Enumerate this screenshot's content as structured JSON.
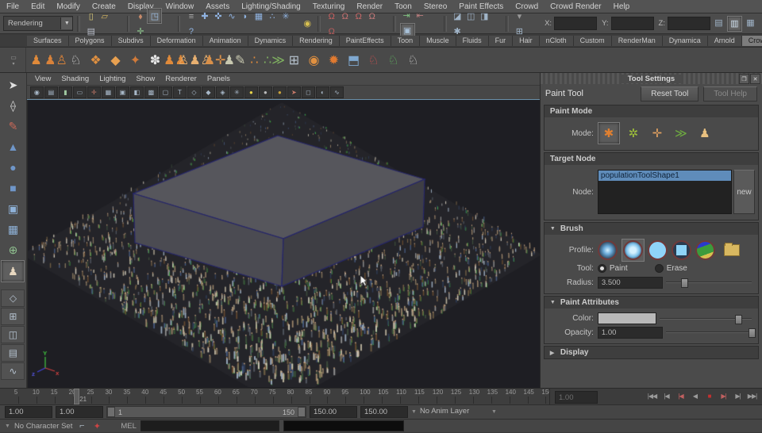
{
  "menu_bar": {
    "items": [
      "File",
      "Edit",
      "Modify",
      "Create",
      "Display",
      "Window",
      "Assets",
      "Lighting/Shading",
      "Texturing",
      "Render",
      "Toon",
      "Stereo",
      "Paint Effects",
      "Crowd",
      "Crowd Render",
      "Help"
    ]
  },
  "status_line": {
    "renderer_menu": "Rendering",
    "file_icons": [
      {
        "n": "new-scene-icon",
        "g": "▯",
        "c": "#d8c878"
      },
      {
        "n": "open-scene-icon",
        "g": "▱",
        "c": "#d8b860"
      },
      {
        "n": "save-scene-icon",
        "g": "▤",
        "c": "#b8bcc8"
      }
    ],
    "selection_icons": [
      {
        "n": "select-hierarchy-icon",
        "g": "⬧",
        "c": "#c88a6a"
      },
      {
        "n": "select-object-icon",
        "g": "◳",
        "c": "#9fc2e8",
        "a": 1
      },
      {
        "n": "select-component-icon",
        "g": "✛",
        "c": "#8fc88f"
      }
    ],
    "mask_icons": [
      {
        "n": "mask-menu-icon",
        "g": "≡",
        "c": "#aaaaaa"
      },
      {
        "n": "select-handles-icon",
        "g": "✚",
        "c": "#8fb2e0"
      },
      {
        "n": "select-joints-icon",
        "g": "✜",
        "c": "#8fb2e0"
      },
      {
        "n": "select-curves-icon",
        "g": "∿",
        "c": "#8fb2e0"
      },
      {
        "n": "select-surfaces-icon",
        "g": "◗",
        "c": "#8fb2e0"
      },
      {
        "n": "select-deformations-icon",
        "g": "▦",
        "c": "#8fb2e0"
      },
      {
        "n": "select-dynamics-icon",
        "g": "∴",
        "c": "#8fb2e0"
      },
      {
        "n": "select-rendering-icon",
        "g": "✳",
        "c": "#8fb2e0"
      },
      {
        "n": "select-misc-icon",
        "g": "?",
        "c": "#8fb2e0"
      }
    ],
    "lock_icon": {
      "n": "lock-selection-icon",
      "g": "◉",
      "c": "#d8c050"
    },
    "snap_icons": [
      {
        "n": "snap-to-grid-icon",
        "g": "Ω",
        "c": "#c86060"
      },
      {
        "n": "snap-to-curve-icon",
        "g": "Ω",
        "c": "#c87272"
      },
      {
        "n": "snap-to-point-icon",
        "g": "Ω",
        "c": "#c86868"
      },
      {
        "n": "snap-to-plane-icon",
        "g": "Ω",
        "c": "#c87c7c"
      },
      {
        "n": "snap-to-surface-icon",
        "g": "Ω",
        "c": "#b85c5c"
      }
    ],
    "history_icons": [
      {
        "n": "input-connections-icon",
        "g": "⇥",
        "c": "#7fbf7f"
      },
      {
        "n": "output-connections-icon",
        "g": "⇤",
        "c": "#bf7f7f"
      },
      {
        "n": "construction-history-icon",
        "g": "▣",
        "c": "#a8c0d8",
        "a": 1
      }
    ],
    "render_icons": [
      {
        "n": "render-view-icon",
        "g": "◪",
        "c": "#a0b4c8"
      },
      {
        "n": "render-current-frame-icon",
        "g": "◫",
        "c": "#a0b4c8"
      },
      {
        "n": "ipr-render-icon",
        "g": "◨",
        "c": "#a0b4c8"
      },
      {
        "n": "render-settings-icon",
        "g": "✱",
        "c": "#a0b4c8"
      }
    ],
    "coord_menu_icons": [
      {
        "n": "quick-select-caret-icon",
        "g": "▾",
        "c": "#999999"
      },
      {
        "n": "selection-mask-grid-icon",
        "g": "⊞",
        "c": "#a0b4c8"
      }
    ],
    "x_label": "X:",
    "y_label": "Y:",
    "z_label": "Z:",
    "x_value": "",
    "y_value": "",
    "z_value": "",
    "panel_toggle_icons": [
      {
        "n": "channel-box-toggle-icon",
        "g": "▤",
        "c": "#a0b4c8"
      },
      {
        "n": "tool-settings-toggle-icon",
        "g": "▥",
        "c": "#d0e0ee",
        "a": 1
      },
      {
        "n": "attribute-editor-toggle-icon",
        "g": "▦",
        "c": "#a0b4c8"
      }
    ]
  },
  "shelf": {
    "active": "Crowd",
    "tabs": [
      {
        "t": "Surfaces"
      },
      {
        "t": "Polygons"
      },
      {
        "t": "Subdivs"
      },
      {
        "t": "Deformation"
      },
      {
        "t": "Animation"
      },
      {
        "t": "Dynamics"
      },
      {
        "t": "Rendering"
      },
      {
        "t": "PaintEffects"
      },
      {
        "t": "Toon"
      },
      {
        "t": "Muscle"
      },
      {
        "t": "Fluids"
      },
      {
        "t": "Fur"
      },
      {
        "t": "Hair"
      },
      {
        "t": "nCloth"
      },
      {
        "t": "Custom"
      },
      {
        "t": "RenderMan"
      },
      {
        "t": "Dynamica"
      },
      {
        "t": "Arnold"
      },
      {
        "t": "Crowd",
        "a": 1
      }
    ],
    "nav_icons": [
      {
        "n": "shelf-tab-left-icon",
        "g": "◀"
      },
      {
        "n": "shelf-tab-right-icon",
        "g": "▶"
      },
      {
        "n": "shelf-trash-icon",
        "g": "▯"
      }
    ],
    "items": [
      {
        "n": "character-maker-icon",
        "g": "♟",
        "c": "#e08a3a"
      },
      {
        "n": "character-pair-icon",
        "g": "♟♙",
        "c": "#d8823a"
      },
      {
        "n": "motion-clip-icon",
        "g": "♘",
        "c": "#d8d8d8"
      },
      {
        "n": "terrain-locator-icon",
        "g": "❖",
        "c": "#e09040"
      },
      {
        "n": "terrain-icon",
        "g": "◆",
        "c": "#e8a050"
      },
      {
        "n": "stamp-icon",
        "g": "✦",
        "c": "#d07a3a"
      },
      {
        "n": "bird-flock-icon",
        "g": "✽",
        "c": "#e8e8e8"
      },
      {
        "n": "population-pair-icon",
        "g": "♟♟",
        "c": "#e08a3a"
      },
      {
        "n": "population-crowd-icon",
        "g": "♙♟♙",
        "c": "#e8b070"
      },
      {
        "n": "population-locator-icon",
        "g": "♟✛",
        "c": "#d8904a"
      },
      {
        "n": "population-paint-icon",
        "g": "♟✎",
        "c": "#c8c8b0"
      },
      {
        "n": "particles-icon",
        "g": "∴",
        "c": "#e08a3a"
      },
      {
        "n": "particles-orient-icon",
        "g": "∴≫",
        "c": "#7fb060"
      },
      {
        "n": "simulation-cache-icon",
        "g": "⊞",
        "c": "#b8c4d0"
      },
      {
        "n": "gauge-icon",
        "g": "◉",
        "c": "#e09040"
      },
      {
        "n": "vortex-icon",
        "g": "✹",
        "c": "#e07a30"
      },
      {
        "n": "cube-emit-icon",
        "g": "⬒",
        "c": "#7fa8d0"
      },
      {
        "n": "walker-export-icon",
        "g": "♘",
        "c": "#c85050"
      },
      {
        "n": "walker-import-icon",
        "g": "♘",
        "c": "#5faf5f"
      },
      {
        "n": "walker-bake-icon",
        "g": "♘",
        "c": "#c8c8c8"
      }
    ]
  },
  "toolbox": {
    "tools": [
      {
        "n": "select-tool-icon",
        "g": "➤",
        "c": "#e0e0e0"
      },
      {
        "n": "lasso-select-tool-icon",
        "g": "⟠",
        "c": "#d0d0d0"
      },
      {
        "n": "paint-select-tool-icon",
        "g": "✎",
        "c": "#c86858"
      },
      {
        "n": "move-tool-icon",
        "g": "▲",
        "c": "#6f96c8"
      },
      {
        "n": "rotate-tool-icon",
        "g": "●",
        "c": "#6f96c8"
      },
      {
        "n": "scale-tool-icon",
        "g": "■",
        "c": "#6f96c8"
      },
      {
        "n": "universal-manipulator-icon",
        "g": "▣",
        "c": "#8fb2d8"
      },
      {
        "n": "soft-modification-tool-icon",
        "g": "▦",
        "c": "#8fb2d8"
      },
      {
        "n": "show-manipulator-icon",
        "g": "⊕",
        "c": "#8fc08f"
      },
      {
        "n": "last-tool-paint-icon",
        "g": "♟",
        "c": "#e8d8c0",
        "a": 1
      }
    ],
    "layouts": [
      {
        "n": "single-pane-layout-button",
        "g": "◇"
      },
      {
        "n": "four-pane-layout-button",
        "g": "⊞"
      },
      {
        "n": "split-pane-layout-button",
        "g": "◫"
      },
      {
        "n": "outliner-layout-button",
        "g": "▤"
      },
      {
        "n": "hypergraph-layout-button",
        "g": "∿"
      }
    ]
  },
  "viewport": {
    "menus": [
      "View",
      "Shading",
      "Lighting",
      "Show",
      "Renderer",
      "Panels"
    ],
    "toolbar_icons": [
      {
        "n": "select-camera-icon",
        "g": "◉"
      },
      {
        "n": "camera-attributes-icon",
        "g": "▤"
      },
      {
        "n": "bookmark-icon",
        "g": "▮",
        "c": "#9fc89f"
      },
      {
        "n": "image-plane-icon",
        "g": "▭"
      },
      {
        "n": "two-d-pan-zoom-icon",
        "g": "✛",
        "c": "#c87a6a"
      },
      {
        "n": "film-gate-icon",
        "g": "▦"
      },
      {
        "n": "resolution-gate-icon",
        "g": "▣"
      },
      {
        "n": "gate-mask-icon",
        "g": "◧"
      },
      {
        "n": "field-chart-icon",
        "g": "▩"
      },
      {
        "n": "safe-action-icon",
        "g": "▢"
      },
      {
        "n": "safe-title-icon",
        "g": "T"
      },
      {
        "n": "wireframe-icon",
        "g": "◇"
      },
      {
        "n": "shaded-icon",
        "g": "◆"
      },
      {
        "n": "textured-icon",
        "g": "◈"
      },
      {
        "n": "use-all-lights-icon",
        "g": "✳"
      },
      {
        "n": "default-lighting-icon",
        "g": "●",
        "c": "#e8d44a"
      },
      {
        "n": "flat-lighting-icon",
        "g": "●",
        "c": "#bbbbbb"
      },
      {
        "n": "no-lights-icon",
        "g": "●",
        "c": "#c8a23a"
      },
      {
        "n": "isolate-select-icon",
        "g": "➤",
        "c": "#c87a6a"
      },
      {
        "n": "xray-icon",
        "g": "◻"
      },
      {
        "n": "exposure-icon",
        "g": "◐"
      },
      {
        "n": "panel-graph-icon",
        "g": "∿"
      }
    ]
  },
  "tool_settings": {
    "title": "Tool Settings",
    "tool_name": "Paint Tool",
    "reset_button": "Reset Tool",
    "help_button": "Tool Help",
    "paint_mode": {
      "title": "Paint Mode",
      "mode_label": "Mode:",
      "mode_buttons": [
        {
          "n": "place-particles-mode-button",
          "g": "✱",
          "c": "#e08030",
          "a": 1
        },
        {
          "n": "colored-particles-mode-button",
          "g": "✲",
          "c": "#9fc03a"
        },
        {
          "n": "move-particles-mode-button",
          "g": "✛",
          "c": "#e0a060"
        },
        {
          "n": "orient-mode-button",
          "g": "≫",
          "c": "#6fae3f"
        },
        {
          "n": "simulate-walk-mode-button",
          "g": "♟",
          "c": "#e8c080"
        }
      ]
    },
    "target_node": {
      "title": "Target Node",
      "node_label": "Node:",
      "selected_node": "populationToolShape1",
      "new_button": "new"
    },
    "brush": {
      "title": "Brush",
      "profile_label": "Profile:",
      "tool_label": "Tool:",
      "paint_radio": "Paint",
      "erase_radio": "Erase",
      "radius_label": "Radius:",
      "radius_value": "3.500"
    },
    "paint_attributes": {
      "title": "Paint Attributes",
      "color_label": "Color:",
      "color_swatch": "#b9b9b9",
      "opacity_label": "Opacity:",
      "opacity_value": "1.00"
    },
    "display": {
      "title": "Display"
    }
  },
  "timeline": {
    "start": 1,
    "end": 150,
    "step": 5,
    "current": 21,
    "current_label": "21",
    "current_time_field": "1.00",
    "playback_buttons": [
      {
        "n": "go-to-start-button",
        "g": "|◀◀"
      },
      {
        "n": "step-back-frame-button",
        "g": "|◀"
      },
      {
        "n": "step-back-key-button",
        "g": "|◀",
        "c": "#c06060"
      },
      {
        "n": "play-backwards-button",
        "g": "◀"
      },
      {
        "n": "stop-playback-button",
        "g": "■",
        "c": "#c23030"
      },
      {
        "n": "step-forward-key-button",
        "g": "▶|",
        "c": "#c06060"
      },
      {
        "n": "step-forward-frame-button",
        "g": "▶|"
      },
      {
        "n": "go-to-end-button",
        "g": "▶▶|"
      }
    ]
  },
  "range_slider": {
    "anim_start": "1.00",
    "playback_start": "1.00",
    "range_start": "1",
    "range_end": "150",
    "playback_end": "150.00",
    "anim_end": "150.00",
    "anim_layer": "No Anim Layer"
  },
  "command_line": {
    "character_set": "No Character Set",
    "auto_key_icon": {
      "n": "auto-keyframe-icon",
      "g": "✦",
      "c": "#cc4444"
    },
    "mel_label": "MEL",
    "input_value": "",
    "output_value": ""
  },
  "scene": {
    "bg": "#1e1e23",
    "platform": "#242429",
    "marker_color": "#3fae3f",
    "palette": [
      "#46597e",
      "#6d5b42",
      "#8d8d8d",
      "#c9c2b2",
      "#3b4a3a",
      "#64492f",
      "#7d6e58",
      "#93a3b5",
      "#2e3a52",
      "#b3ab97",
      "#50555e",
      "#9a8468"
    ],
    "box": {
      "top": "#56565c",
      "left": "#4b4b52",
      "right": "#3e3e44",
      "edge": "#26266a"
    },
    "count": 4600
  }
}
